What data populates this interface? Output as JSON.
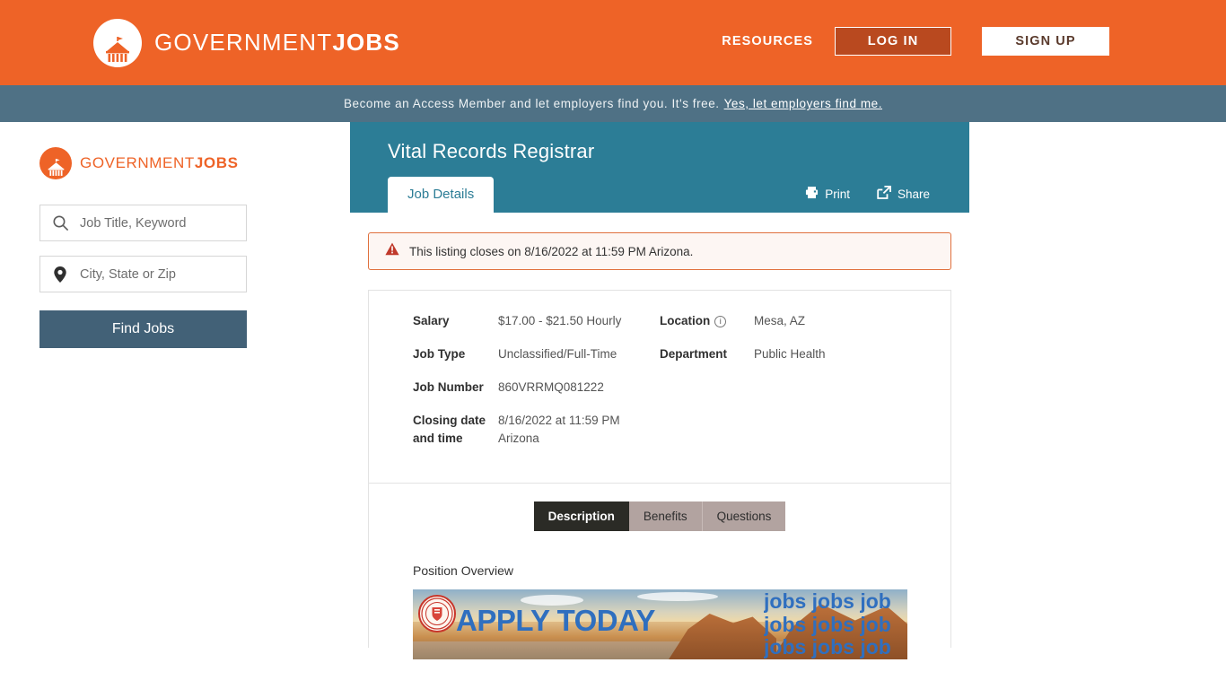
{
  "header": {
    "brand_first": "GOVERNMENT",
    "brand_second": "JOBS",
    "brand_icon": "capitol-building-icon",
    "resources_label": "RESOURCES",
    "login_label": "LOG IN",
    "signup_label": "SIGN UP",
    "accent_orange": "#ee6327",
    "login_bg": "#b9491f"
  },
  "promo_banner": {
    "text": "Become an Access Member and let employers find you. It's free.",
    "link_text": "Yes, let employers find me.",
    "bg_color": "#4f7185"
  },
  "sidebar": {
    "brand_first": "GOVERNMENT",
    "brand_second": "JOBS",
    "brand_icon": "capitol-building-icon",
    "keyword_field": {
      "icon": "search-icon",
      "placeholder": "Job Title, Keyword",
      "value": ""
    },
    "location_field": {
      "icon": "map-pin-icon",
      "placeholder": "City, State or Zip",
      "value": ""
    },
    "find_jobs_label": "Find Jobs",
    "find_jobs_color": "#426177"
  },
  "job": {
    "title": "Vital Records Registrar",
    "header_bg": "#2c7d96",
    "tab_label": "Job Details",
    "print_label": "Print",
    "print_icon": "printer-icon",
    "share_label": "Share",
    "share_icon": "share-icon",
    "alert": {
      "icon": "warning-triangle-icon",
      "text": "This listing closes on 8/16/2022 at 11:59 PM Arizona.",
      "border_color": "#e0703d"
    },
    "details_left": [
      {
        "label": "Salary",
        "value": "$17.00 - $21.50 Hourly"
      },
      {
        "label": "Job Type",
        "value": "Unclassified/Full-Time"
      },
      {
        "label": "Job Number",
        "value": "860VRRMQ081222"
      },
      {
        "label": "Closing date and time",
        "value": "8/16/2022 at 11:59 PM Arizona"
      }
    ],
    "details_right": [
      {
        "label": "Location",
        "value": "Mesa, AZ",
        "icon": "info-icon"
      },
      {
        "label": "Department",
        "value": "Public Health"
      }
    ],
    "content_tabs": [
      {
        "label": "Description",
        "active": true
      },
      {
        "label": "Benefits",
        "active": false
      },
      {
        "label": "Questions",
        "active": false
      }
    ],
    "active_tab_bg": "#2b2b26",
    "inactive_tab_bg": "#b2a3a0",
    "section_heading": "Position Overview",
    "promo_image": {
      "alt": "maricopa-county-apply-today-banner",
      "apply_text": "APPLY TODAY",
      "jobs_row_1": "jobs jobs job",
      "jobs_row_2": "jobs jobs job",
      "jobs_row_3": "jobs jobs job",
      "seal_label": "MARICOPA COUNTY",
      "text_color": "#2f6fbf"
    }
  }
}
